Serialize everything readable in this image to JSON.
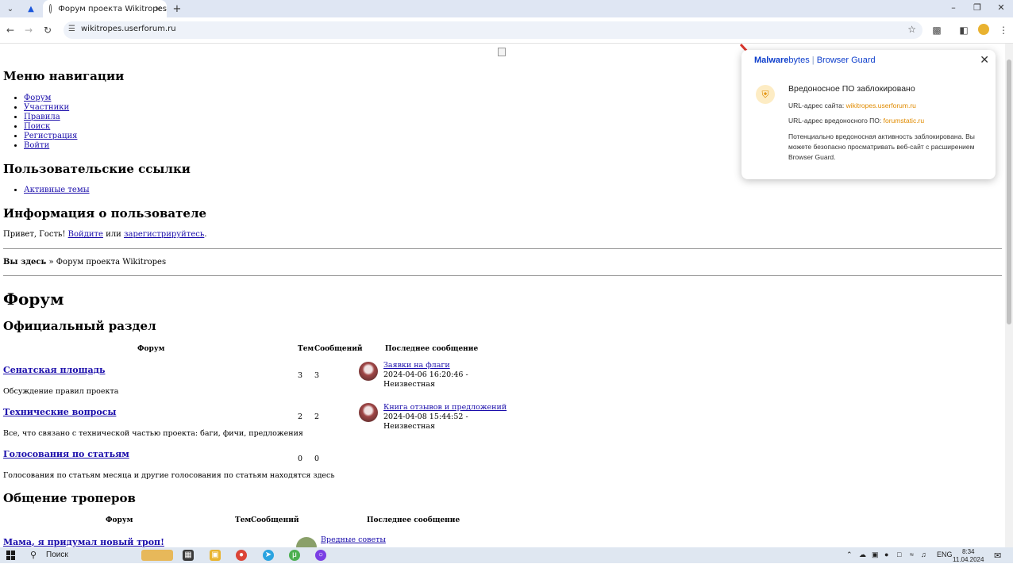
{
  "browser": {
    "tab_title": "Форум проекта Wikitropes",
    "url": "wikitropes.userforum.ru"
  },
  "nav": {
    "heading": "Меню навигации",
    "items": [
      "Форум",
      "Участники",
      "Правила",
      "Поиск",
      "Регистрация",
      "Войти"
    ]
  },
  "user_links": {
    "heading": "Пользовательские ссылки",
    "items": [
      "Активные темы"
    ]
  },
  "user_info": {
    "heading": "Информация о пользователе",
    "greeting": "Привет, Гость!",
    "login": "Войдите",
    "or": "или",
    "register": "зарегистрируйтесь",
    "end": "."
  },
  "breadcrumb": {
    "label": "Вы здесь",
    "sep": "»",
    "current": "Форум проекта Wikitropes"
  },
  "main": {
    "title": "Форум"
  },
  "sections": [
    {
      "title": "Официальный раздел",
      "headers": {
        "forum": "Форум",
        "topics": "Тем",
        "posts": "Сообщений",
        "last": "Последнее сообщение"
      },
      "forums": [
        {
          "name": "Сенатская площадь",
          "desc": "Обсуждение правил проекта",
          "topics": "3",
          "posts": "3",
          "last_title": "Заявки на флаги",
          "last_date": "2024-04-06 16:20:46 -",
          "last_author": "Неизвестная"
        },
        {
          "name": "Технические вопросы",
          "desc": "Все, что связано с технической частью проекта: баги, фичи, предложения",
          "topics": "2",
          "posts": "2",
          "last_title": "Книга отзывов и предложений",
          "last_date": "2024-04-08 15:44:52 -",
          "last_author": "Неизвестная"
        },
        {
          "name": "Голосования по статьям",
          "desc": "Голосования по статьям месяца и другие голосования по статьям находятся здесь",
          "topics": "0",
          "posts": "0"
        }
      ]
    },
    {
      "title": "Общение троперов",
      "headers": {
        "forum": "Форум",
        "topics": "Тем",
        "posts": "Сообщений",
        "last": "Последнее сообщение"
      },
      "forums": [
        {
          "name": "Мама, я придумал новый троп!",
          "last_title": "Вредные советы"
        }
      ]
    }
  ],
  "popup": {
    "brand_bold": "Malware",
    "brand_rest": "bytes",
    "brand_sep": "|",
    "brand_product": "Browser Guard",
    "headline": "Вредоносное ПО заблокировано",
    "site_label": "URL-адрес сайта:",
    "site_value": "wikitropes.userforum.ru",
    "malware_label": "URL-адрес вредоносного ПО:",
    "malware_value": "forumstatic.ru",
    "description": "Потенциально вредоносная активность заблокирована. Вы можете безопасно просматривать веб-сайт с расширением Browser Guard."
  },
  "taskbar": {
    "search_label": "Поиск",
    "lang": "ENG",
    "time": "8:34",
    "date": "11.04.2024"
  },
  "colors": {
    "link": "#1a0dab",
    "mb_blue": "#0d3ecc",
    "mb_orange": "#e08b00",
    "arrow_red": "#d9342b"
  }
}
